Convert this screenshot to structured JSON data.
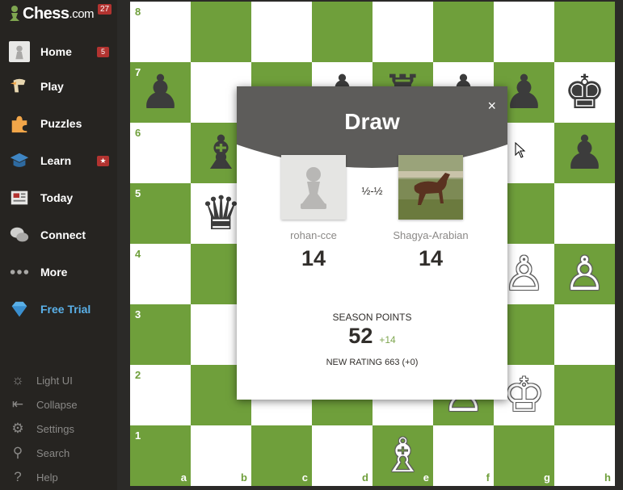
{
  "logo": {
    "brand": "Chess",
    "suffix": ".com",
    "badge": "27"
  },
  "nav": [
    {
      "label": "Home",
      "icon": "home-avatar-icon",
      "badge": "5"
    },
    {
      "label": "Play",
      "icon": "play-icon",
      "badge": ""
    },
    {
      "label": "Puzzles",
      "icon": "puzzle-icon",
      "badge": ""
    },
    {
      "label": "Learn",
      "icon": "learn-icon",
      "badge": "★"
    },
    {
      "label": "Today",
      "icon": "today-icon",
      "badge": ""
    },
    {
      "label": "Connect",
      "icon": "connect-icon",
      "badge": ""
    },
    {
      "label": "More",
      "icon": "more-icon",
      "badge": ""
    },
    {
      "label": "Free Trial",
      "icon": "diamond-icon",
      "badge": ""
    }
  ],
  "utilities": [
    {
      "label": "Light UI",
      "icon": "sun-icon"
    },
    {
      "label": "Collapse",
      "icon": "collapse-icon"
    },
    {
      "label": "Settings",
      "icon": "gear-icon"
    },
    {
      "label": "Search",
      "icon": "search-icon"
    },
    {
      "label": "Help",
      "icon": "help-icon"
    }
  ],
  "board": {
    "ranks": [
      "8",
      "7",
      "6",
      "5",
      "4",
      "3",
      "2",
      "1"
    ],
    "files": [
      "a",
      "b",
      "c",
      "d",
      "e",
      "f",
      "g",
      "h"
    ],
    "light_color": "#ffffff",
    "dark_color": "#6f9f3b",
    "pieces": [
      {
        "square": "a7",
        "piece": "♟",
        "color": "black"
      },
      {
        "square": "d7",
        "piece": "♟",
        "color": "black"
      },
      {
        "square": "e7",
        "piece": "♜",
        "color": "black"
      },
      {
        "square": "f7",
        "piece": "♟",
        "color": "black"
      },
      {
        "square": "g7",
        "piece": "♟",
        "color": "black"
      },
      {
        "square": "h7",
        "piece": "♚",
        "color": "black"
      },
      {
        "square": "b6",
        "piece": "♝",
        "color": "black"
      },
      {
        "square": "h6",
        "piece": "♟",
        "color": "black"
      },
      {
        "square": "b5",
        "piece": "♛",
        "color": "black"
      },
      {
        "square": "g4",
        "piece": "♙",
        "color": "white"
      },
      {
        "square": "h4",
        "piece": "♙",
        "color": "white"
      },
      {
        "square": "f2",
        "piece": "♙",
        "color": "white"
      },
      {
        "square": "g2",
        "piece": "♔",
        "color": "white"
      },
      {
        "square": "e1",
        "piece": "♗",
        "color": "white"
      }
    ]
  },
  "modal": {
    "title": "Draw",
    "close": "×",
    "result": "½-½",
    "player1": {
      "name": "rohan-cce",
      "score": "14",
      "avatar": "pawn-avatar-icon"
    },
    "player2": {
      "name": "Shagya-Arabian",
      "score": "14",
      "avatar": "horse-avatar-image"
    },
    "season_label": "SEASON POINTS",
    "season_points": "52",
    "season_delta": "+14",
    "new_rating": "NEW RATING 663 (+0)",
    "header_color": "#5d5c5a"
  }
}
